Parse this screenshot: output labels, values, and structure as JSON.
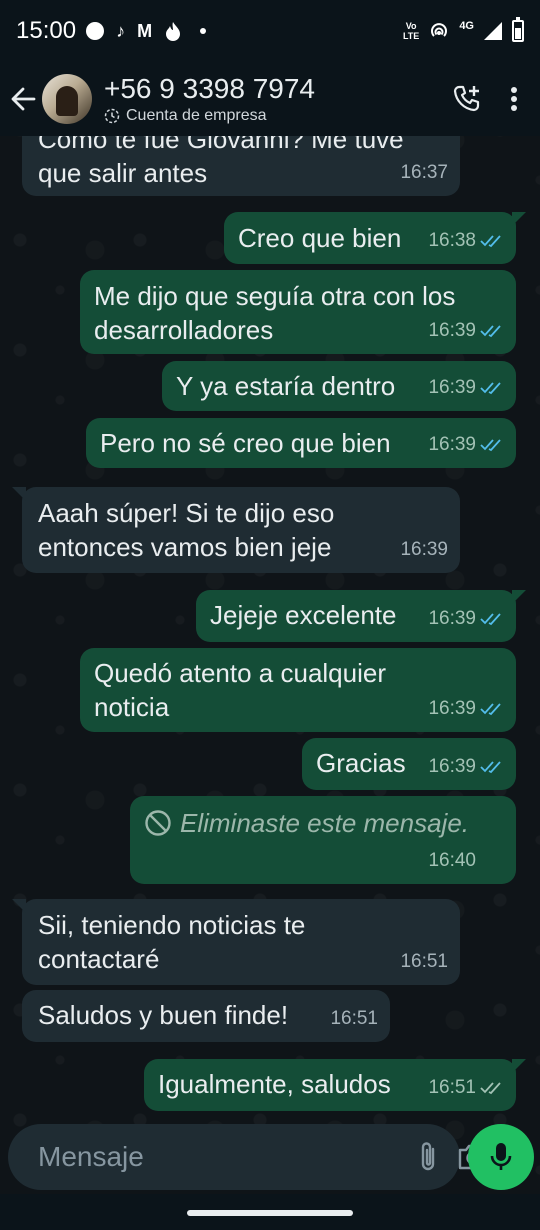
{
  "status_bar": {
    "time": "15:00",
    "volte_top": "Vo",
    "volte_bottom": "LTE",
    "network": "4G"
  },
  "header": {
    "contact_name": "+56 9 3398 7974",
    "subtitle": "Cuenta de empresa"
  },
  "messages": [
    {
      "direction": "in",
      "text": "Como te fue Giovanni? Me tuve que salir antes",
      "time": "16:37"
    },
    {
      "direction": "out",
      "text": "Creo que bien",
      "time": "16:38",
      "status": "read"
    },
    {
      "direction": "out",
      "text": "Me dijo que seguía otra con los desarrolladores",
      "time": "16:39",
      "status": "read"
    },
    {
      "direction": "out",
      "text": "Y ya estaría dentro",
      "time": "16:39",
      "status": "read"
    },
    {
      "direction": "out",
      "text": "Pero no sé creo que bien",
      "time": "16:39",
      "status": "read"
    },
    {
      "direction": "in",
      "text": "Aaah súper! Si te dijo eso entonces vamos bien jeje",
      "time": "16:39"
    },
    {
      "direction": "out",
      "text": "Jejeje excelente",
      "time": "16:39",
      "status": "read"
    },
    {
      "direction": "out",
      "text": "Quedó atento a cualquier noticia",
      "time": "16:39",
      "status": "read"
    },
    {
      "direction": "out",
      "text": "Gracias",
      "time": "16:39",
      "status": "read"
    },
    {
      "direction": "out",
      "text": "Eliminaste este mensaje.",
      "time": "16:40",
      "deleted": true
    },
    {
      "direction": "in",
      "text": "Sii, teniendo noticias te contactaré",
      "time": "16:51"
    },
    {
      "direction": "in",
      "text": "Saludos y buen finde!",
      "time": "16:51"
    },
    {
      "direction": "out",
      "text": "Igualmente, saludos",
      "time": "16:51",
      "status": "delivered"
    }
  ],
  "composer": {
    "placeholder": "Mensaje"
  },
  "colors": {
    "incoming_bubble": "#1f2c33",
    "outgoing_bubble": "#144d37",
    "read_ticks": "#53bdeb",
    "delivered_ticks": "#a3c2b5",
    "mic_button": "#21c063"
  },
  "icons": {
    "back": "arrow-left-icon",
    "add_call": "phone-plus-icon",
    "menu": "more-vertical-icon",
    "emoji": "sticker-icon",
    "attach": "paperclip-icon",
    "camera": "camera-icon",
    "mic": "mic-icon",
    "deleted": "prohibited-icon"
  }
}
